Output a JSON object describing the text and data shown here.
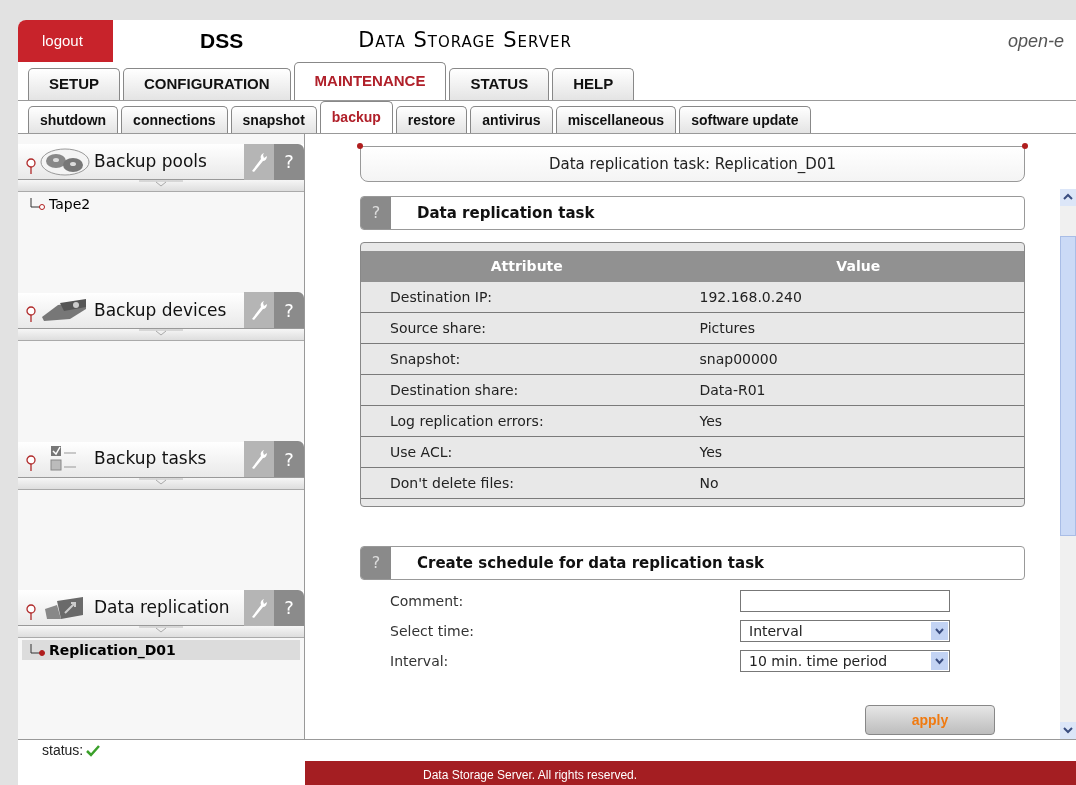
{
  "header": {
    "logout": "logout",
    "product": "DSS",
    "title": "Data Storage Server",
    "brand": "open-e"
  },
  "main_tabs": [
    {
      "label": "SETUP",
      "selected": false
    },
    {
      "label": "CONFIGURATION",
      "selected": false
    },
    {
      "label": "MAINTENANCE",
      "selected": true
    },
    {
      "label": "STATUS",
      "selected": false
    },
    {
      "label": "HELP",
      "selected": false
    }
  ],
  "sub_tabs": [
    {
      "label": "shutdown",
      "selected": false
    },
    {
      "label": "connections",
      "selected": false
    },
    {
      "label": "snapshot",
      "selected": false
    },
    {
      "label": "backup",
      "selected": true
    },
    {
      "label": "restore",
      "selected": false
    },
    {
      "label": "antivirus",
      "selected": false
    },
    {
      "label": "miscellaneous",
      "selected": false
    },
    {
      "label": "software update",
      "selected": false
    }
  ],
  "sidebar": {
    "sections": [
      {
        "kind": "pools",
        "title": "Backup pools",
        "help": "?",
        "items": [
          {
            "label": "Tape2",
            "selected": false
          }
        ]
      },
      {
        "kind": "devices",
        "title": "Backup devices",
        "help": "?"
      },
      {
        "kind": "tasks",
        "title": "Backup tasks",
        "help": "?"
      },
      {
        "kind": "replication",
        "title": "Data replication",
        "help": "?",
        "items": [
          {
            "label": "Replication_D01",
            "selected": true
          }
        ]
      }
    ]
  },
  "page_title": "Data replication task: Replication_D01",
  "task_panel": {
    "help": "?",
    "title": "Data replication task",
    "table": {
      "columns": [
        "Attribute",
        "Value"
      ],
      "rows": [
        [
          "Destination IP:",
          "192.168.0.240"
        ],
        [
          "Source share:",
          "Pictures"
        ],
        [
          "Snapshot:",
          "snap00000"
        ],
        [
          "Destination share:",
          "Data-R01"
        ],
        [
          "Log replication errors:",
          "Yes"
        ],
        [
          "Use ACL:",
          "Yes"
        ],
        [
          "Don't delete files:",
          "No"
        ]
      ]
    }
  },
  "schedule_panel": {
    "help": "?",
    "title": "Create schedule for data replication task",
    "fields": [
      {
        "kind": "text",
        "label": "Comment:"
      },
      {
        "kind": "select",
        "label": "Select time:",
        "value": "Interval"
      },
      {
        "kind": "select",
        "label": "Interval:",
        "value": "10 min. time period"
      }
    ],
    "apply": "apply"
  },
  "status_bar": {
    "label": "status:",
    "ok": true
  },
  "footer": "Data Storage Server. All rights reserved."
}
